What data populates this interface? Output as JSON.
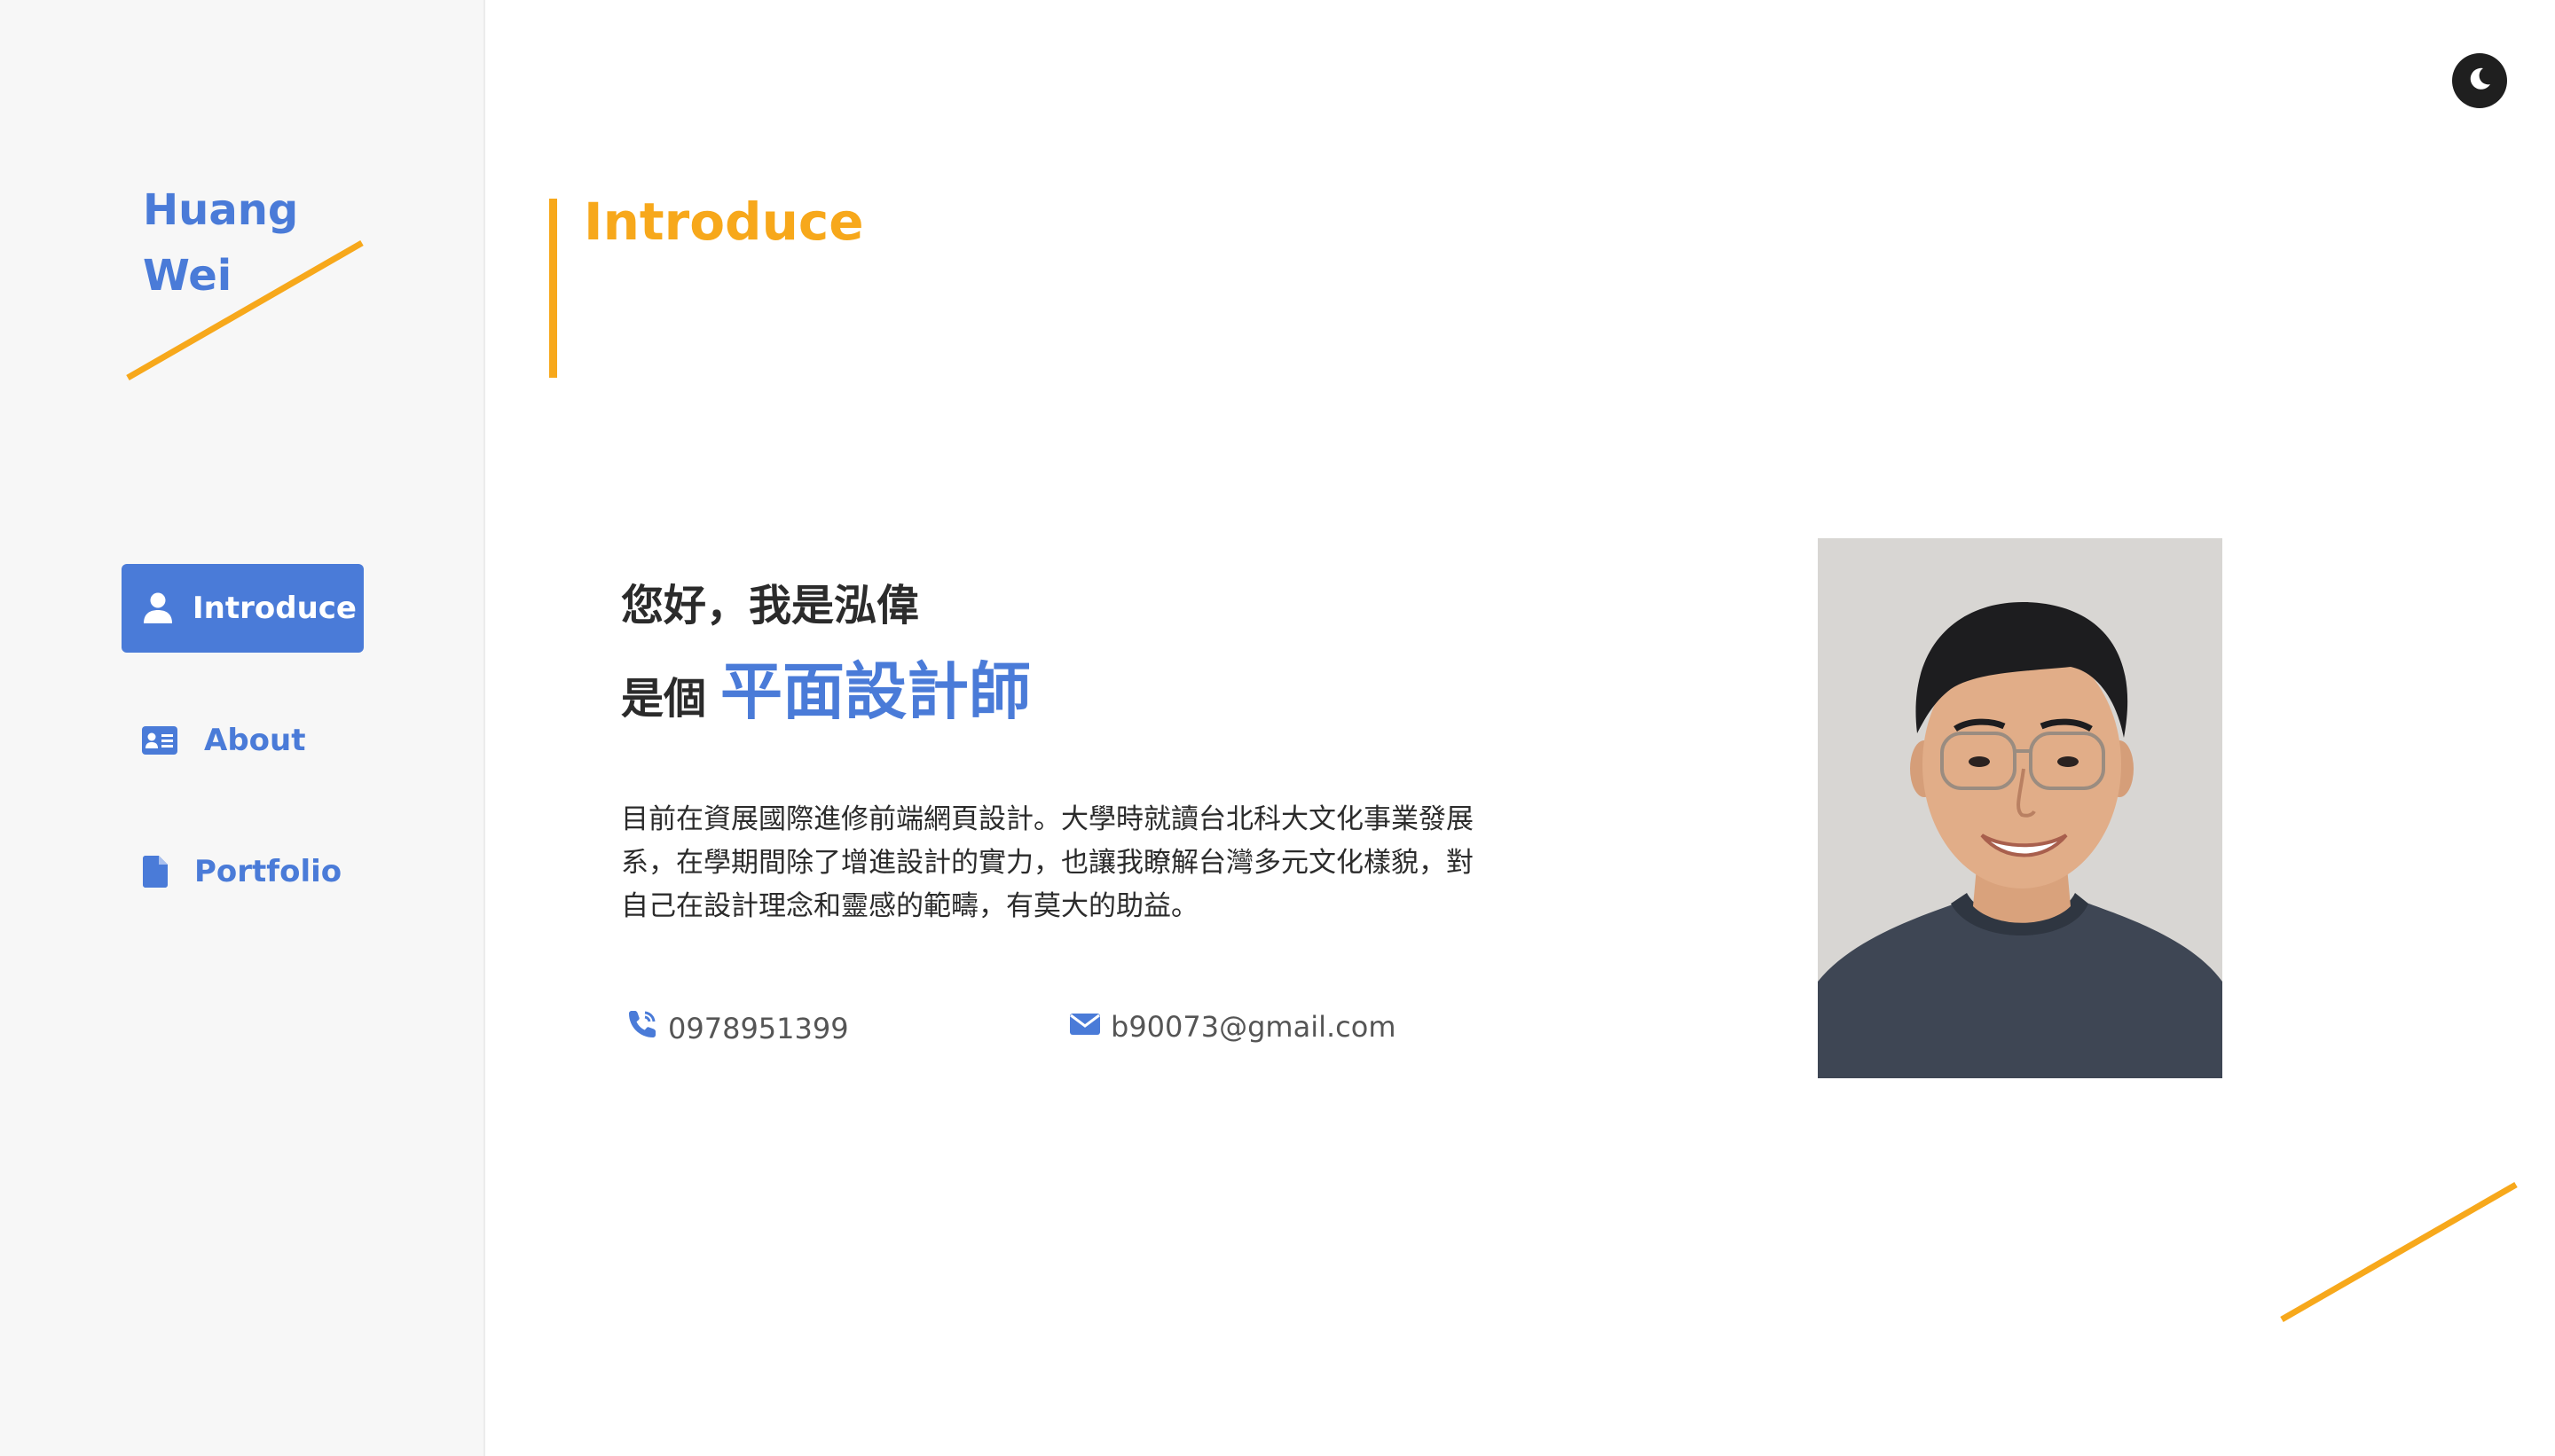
{
  "sidebar": {
    "logo_line1": "Huang",
    "logo_line2": "Wei",
    "nav": [
      {
        "label": "Introduce",
        "icon": "user-icon",
        "active": true
      },
      {
        "label": "About",
        "icon": "id-card-icon",
        "active": false
      },
      {
        "label": "Portfolio",
        "icon": "file-icon",
        "active": false
      }
    ]
  },
  "header": {
    "theme_toggle_icon": "moon-icon"
  },
  "main": {
    "section_title": "Introduce",
    "greeting": "您好，我是泓偉",
    "role_prefix": "是個",
    "role_highlight": "平面設計師",
    "bio": "目前在資展國際進修前端網頁設計。大學時就讀台北科大文化事業發展系，在學期間除了增進設計的實力，也讓我瞭解台灣多元文化樣貌，對自己在設計理念和靈感的範疇，有莫大的助益。",
    "phone": "0978951399",
    "email": "b90073@gmail.com",
    "phone_icon": "phone-icon",
    "email_icon": "envelope-icon",
    "photo": "profile-photo"
  },
  "colors": {
    "accent_blue": "#4a7bd8",
    "accent_orange": "#f7a81b",
    "sidebar_bg": "#f7f7f7",
    "text_dark": "#2b2b2b"
  }
}
